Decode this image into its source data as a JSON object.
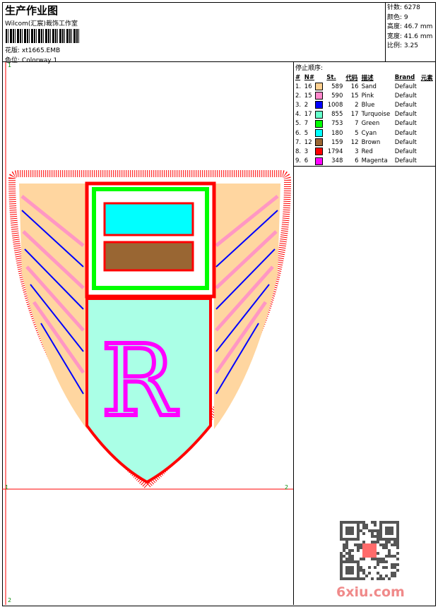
{
  "header": {
    "title": "生产作业图",
    "company": "Wilcom(汇宸)裁饰工作室",
    "design_label": "花版:",
    "design_file": "xt1665.EMB",
    "colorway_label": "色位:",
    "colorway": "Colorway 1"
  },
  "stats": [
    {
      "label": "针数:",
      "value": "6278"
    },
    {
      "label": "颜色:",
      "value": "9"
    },
    {
      "label": "高度:",
      "value": "46.7 mm"
    },
    {
      "label": "宽度:",
      "value": "41.6 mm"
    },
    {
      "label": "比例:",
      "value": "3.25"
    }
  ],
  "stop_sequence": {
    "title": "停止顺序:",
    "columns": [
      "#",
      "N#",
      "St.",
      "代码",
      "描述",
      "Brand",
      "元素"
    ],
    "rows": [
      {
        "idx": "1.",
        "n": "16",
        "color": "#ffd090",
        "st": "589",
        "code": "16",
        "desc": "Sand",
        "brand": "Default"
      },
      {
        "idx": "2.",
        "n": "15",
        "color": "#ff88cc",
        "st": "590",
        "code": "15",
        "desc": "Pink",
        "brand": "Default"
      },
      {
        "idx": "3.",
        "n": "2",
        "color": "#0000ff",
        "st": "1008",
        "code": "2",
        "desc": "Blue",
        "brand": "Default"
      },
      {
        "idx": "4.",
        "n": "17",
        "color": "#66ffcc",
        "st": "855",
        "code": "17",
        "desc": "Turquoise",
        "brand": "Default"
      },
      {
        "idx": "5.",
        "n": "7",
        "color": "#00ff00",
        "st": "753",
        "code": "7",
        "desc": "Green",
        "brand": "Default"
      },
      {
        "idx": "6.",
        "n": "5",
        "color": "#00ffff",
        "st": "180",
        "code": "5",
        "desc": "Cyan",
        "brand": "Default"
      },
      {
        "idx": "7.",
        "n": "12",
        "color": "#996633",
        "st": "159",
        "code": "12",
        "desc": "Brown",
        "brand": "Default"
      },
      {
        "idx": "8.",
        "n": "3",
        "color": "#ff0000",
        "st": "1794",
        "code": "3",
        "desc": "Red",
        "brand": "Default"
      },
      {
        "idx": "9.",
        "n": "6",
        "color": "#ff00ff",
        "st": "348",
        "code": "6",
        "desc": "Magenta",
        "brand": "Default"
      }
    ]
  },
  "canvas_marks": {
    "m1": "1",
    "m2": "1",
    "m3": "2",
    "m4": "2"
  },
  "watermark": "6xiu.com"
}
